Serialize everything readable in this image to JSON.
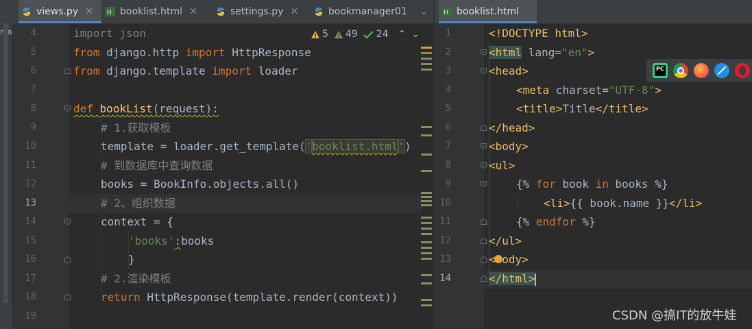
{
  "sidebar": {
    "cut_text": "mar"
  },
  "left_editor": {
    "tabs": [
      {
        "label": "views.py",
        "icon": "python-file-icon",
        "active": true
      },
      {
        "label": "booklist.html",
        "icon": "html-file-icon",
        "active": false
      },
      {
        "label": "settings.py",
        "icon": "python-file-icon",
        "active": false
      },
      {
        "label": "bookmanager01",
        "icon": "python-file-icon",
        "active": false
      }
    ],
    "inspections": {
      "warnings": "5",
      "weak_warnings": "49",
      "typos": "24"
    },
    "line_numbers": [
      "4",
      "5",
      "6",
      "7",
      "8",
      "9",
      "10",
      "11",
      "12",
      "13",
      "14",
      "15",
      "16",
      "17",
      "18",
      "19"
    ],
    "current_line": "13",
    "code": {
      "l4": {
        "a": "import json"
      },
      "l5": {
        "a": "from",
        "b": " django.http ",
        "c": "import",
        "d": " HttpResponse"
      },
      "l6": {
        "a": "from",
        "b": " django.template ",
        "c": "import",
        "d": " loader"
      },
      "l8": {
        "a": "def",
        "b": " ",
        "c": "bookList",
        "d": "(request):"
      },
      "l9": {
        "a": "# 1.获取模板"
      },
      "l10": {
        "a": "template = loader.get_template(",
        "b": "'",
        "c": "booklist.html",
        "d": "'",
        "e": ")"
      },
      "l11": {
        "a": "# 到数据库中查询数据"
      },
      "l12": {
        "a": "books = BookInfo.objects.all()"
      },
      "l13": {
        "a": "# 2、组织数据"
      },
      "l14": {
        "a": "context = {"
      },
      "l15": {
        "a": "'books'",
        "b": ":",
        "c": "books"
      },
      "l16": {
        "a": "}"
      },
      "l17": {
        "a": "# 2.渲染模板"
      },
      "l18": {
        "a": "return",
        "b": " HttpResponse(template.render(context))"
      }
    }
  },
  "right_editor": {
    "tab": {
      "label": "booklist.html",
      "icon": "html-file-icon"
    },
    "line_numbers": [
      "1",
      "2",
      "3",
      "4",
      "5",
      "6",
      "7",
      "8",
      "9",
      "10",
      "11",
      "12",
      "13",
      "14"
    ],
    "current_line": "14",
    "code": {
      "l1": {
        "a": "<!DOCTYPE html>"
      },
      "l2": {
        "a": "<html",
        "b": " lang=",
        "c": "\"en\"",
        "d": ">"
      },
      "l3": {
        "a": "<head>"
      },
      "l4": {
        "a": "<meta",
        "b": " charset=",
        "c": "\"UTF-8\"",
        "d": ">"
      },
      "l5": {
        "a": "<title>",
        "b": "Title",
        "c": "</title>"
      },
      "l6": {
        "a": "</head>"
      },
      "l7": {
        "a": "<body>"
      },
      "l8": {
        "a": "<ul>"
      },
      "l9": {
        "a": "{%",
        "b": " for ",
        "c": "book",
        "d": " in ",
        "e": "books",
        "f": " %}"
      },
      "l10": {
        "a": "<li>",
        "b": "{{ book.name }}",
        "c": "</li>"
      },
      "l11": {
        "a": "{%",
        "b": " endfor ",
        "c": "%}"
      },
      "l12": {
        "a": "</ul>"
      },
      "l13": {
        "a": "<",
        "b": "ody>"
      },
      "l14": {
        "a": "</html>"
      }
    },
    "browsers": [
      "pycharm-icon",
      "chrome-icon",
      "firefox-icon",
      "safari-icon",
      "opera-icon"
    ]
  },
  "watermark": "CSDN @搞IT的放牛娃",
  "colors": {
    "background": "#2b2b2b",
    "keyword": "#cc7832",
    "string": "#6a8759",
    "function": "#ffc66d",
    "comment": "#808080",
    "tag": "#e8bf6a",
    "accent": "#4a88c7"
  }
}
